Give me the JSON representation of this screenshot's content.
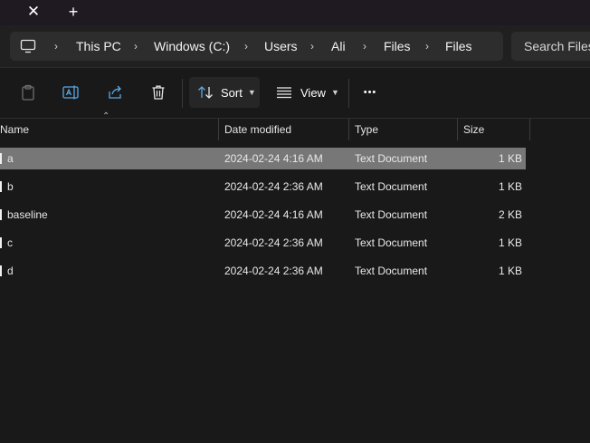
{
  "tabs": {
    "close_symbol": "✕",
    "new_symbol": "+"
  },
  "address": {
    "icon": "computer-icon",
    "crumbs": [
      "This PC",
      "Windows (C:)",
      "Users",
      "Ali",
      "Files",
      "Files"
    ],
    "separator": "›"
  },
  "search": {
    "placeholder": "Search Files"
  },
  "toolbar": {
    "icons": [
      "paste-icon",
      "rename-icon",
      "share-icon",
      "delete-icon"
    ],
    "sort_label": "Sort",
    "view_label": "View",
    "more_symbol": "•••"
  },
  "columns": {
    "name": "Name",
    "date": "Date modified",
    "type": "Type",
    "size": "Size"
  },
  "files": [
    {
      "name": "a",
      "date": "2024-02-24 4:16 AM",
      "type": "Text Document",
      "size": "1 KB",
      "selected": true
    },
    {
      "name": "b",
      "date": "2024-02-24 2:36 AM",
      "type": "Text Document",
      "size": "1 KB",
      "selected": false
    },
    {
      "name": "baseline",
      "date": "2024-02-24 4:16 AM",
      "type": "Text Document",
      "size": "2 KB",
      "selected": false
    },
    {
      "name": "c",
      "date": "2024-02-24 2:36 AM",
      "type": "Text Document",
      "size": "1 KB",
      "selected": false
    },
    {
      "name": "d",
      "date": "2024-02-24 2:36 AM",
      "type": "Text Document",
      "size": "1 KB",
      "selected": false
    }
  ],
  "colors": {
    "background": "#191919",
    "selected_row": "#777777",
    "address_bar": "#2d2d2d"
  }
}
